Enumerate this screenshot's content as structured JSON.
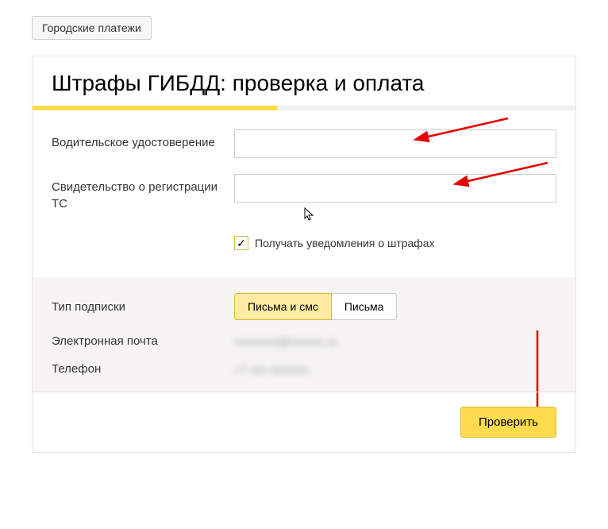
{
  "breadcrumb": {
    "label": "Городские платежи"
  },
  "page": {
    "title": "Штрафы ГИБДД: проверка и оплата"
  },
  "form": {
    "driver_license_label": "Водительское удостоверение",
    "driver_license_value": "",
    "registration_label": "Свидетельство о регистрации ТС",
    "registration_value": "",
    "notifications_checkbox_label": "Получать уведомления о штрафах",
    "notifications_checked": true
  },
  "subscription": {
    "type_label": "Тип подписки",
    "option_both": "Письма и смс",
    "option_letters": "Письма",
    "email_label": "Электронная почта",
    "email_value": "xxxxxxxx@xxxxxx.xx",
    "phone_label": "Телефон",
    "phone_value": "+7 xxx xxxxxxx"
  },
  "footer": {
    "check_button": "Проверить"
  },
  "annotations": {
    "arrow1": true,
    "arrow2": true,
    "arrow3": true,
    "cursor": true
  }
}
